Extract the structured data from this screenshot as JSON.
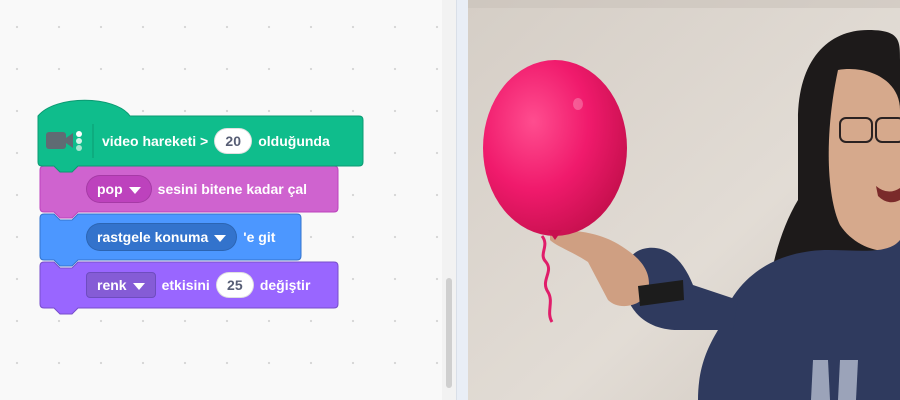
{
  "workspace": {
    "hat_block": {
      "icon": "video-camera-icon",
      "text_before": "video hareketi >",
      "value": "20",
      "text_after": "olduğunda",
      "color": "#0fbd8c"
    },
    "sound_block": {
      "sound_option": "pop",
      "text": "sesini bitene kadar çal",
      "color": "#cf63cf"
    },
    "motion_block": {
      "target_option": "rastgele konuma",
      "text": "'e git",
      "color": "#4c97ff"
    },
    "looks_block": {
      "effect_option": "renk",
      "text": "etkisini",
      "value": "25",
      "text_after": "değiştir",
      "color": "#9966ff"
    }
  },
  "stage": {
    "balloon_color": "#f01a6c",
    "wall_color": "#ddd6cf",
    "icon": "balloon-sprite-icon"
  }
}
